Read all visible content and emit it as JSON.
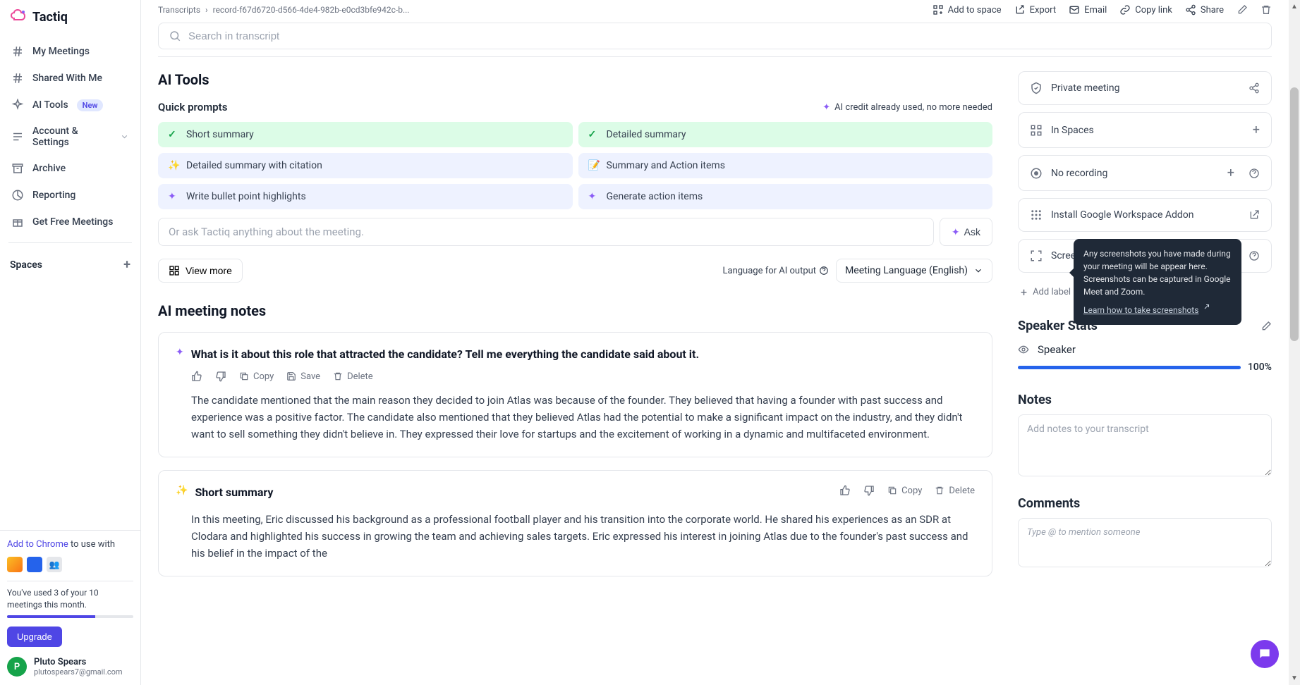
{
  "brand": "Tactiq",
  "sidebar": {
    "items": [
      {
        "label": "My Meetings"
      },
      {
        "label": "Shared With Me"
      },
      {
        "label": "AI Tools"
      },
      {
        "label": "Account & Settings"
      },
      {
        "label": "Archive"
      },
      {
        "label": "Reporting"
      },
      {
        "label": "Get Free Meetings"
      }
    ],
    "new_badge": "New",
    "spaces_label": "Spaces",
    "add_chrome_link": "Add to Chrome",
    "add_chrome_suffix": " to use with",
    "usage_text": "You've used 3 of your 10 meetings this month.",
    "upgrade": "Upgrade",
    "user_name": "Pluto Spears",
    "user_email": "plutospears7@gmail.com",
    "user_initial": "P"
  },
  "breadcrumb": {
    "root": "Transcripts",
    "current": "record-f67d6720-d566-4de4-982b-e0cd3bfe942c-b..."
  },
  "top_actions": {
    "add_space": "Add to space",
    "export": "Export",
    "email": "Email",
    "copy_link": "Copy link",
    "share": "Share"
  },
  "search_placeholder": "Search in transcript",
  "ai_tools_title": "AI Tools",
  "quick_prompts_label": "Quick prompts",
  "credit_text": "AI credit already used, no more needed",
  "prompts": {
    "short_summary": "Short summary",
    "detailed_summary": "Detailed summary",
    "detailed_citation": "Detailed summary with citation",
    "summary_actions": "Summary and Action items",
    "bullet_highlights": "Write bullet point highlights",
    "gen_actions": "Generate action items"
  },
  "ask_placeholder": "Or ask Tactiq anything about the meeting.",
  "ask_btn": "Ask",
  "view_more": "View more",
  "lang_label": "Language for AI output",
  "lang_value": "Meeting Language (English)",
  "notes_title": "AI meeting notes",
  "note1": {
    "title": "What is it about this role that attracted the candidate? Tell me everything the candidate said about it.",
    "body": "The candidate mentioned that the main reason they decided to join Atlas was because of the founder. They believed that having a founder with past success and experience was a positive factor. The candidate also mentioned that they believed Atlas had the potential to make a significant impact on the industry, and they didn't want to sell something they didn't believe in. They expressed their love for startups and the excitement of working in a dynamic and multifaceted environment."
  },
  "note2": {
    "title": "Short summary",
    "body": "In this meeting, Eric discussed his background as a professional football player and his transition into the corporate world. He shared his experiences as an SDR at Clodara and highlighted his success in growing the team and achieving sales targets. Eric expressed his interest in joining Atlas due to the founder's past success and his belief in the impact of the"
  },
  "note_actions": {
    "copy": "Copy",
    "save": "Save",
    "delete": "Delete"
  },
  "right": {
    "private": "Private meeting",
    "in_spaces": "In Spaces",
    "no_recording": "No recording",
    "install_addon": "Install Google Workspace Addon",
    "screenshots": "Screens",
    "add_label": "Add label",
    "speaker_stats": "Speaker Stats",
    "speaker": "Speaker",
    "percent": "100%",
    "notes": "Notes",
    "notes_placeholder": "Add notes to your transcript",
    "comments": "Comments",
    "comments_placeholder": "Type @ to mention someone"
  },
  "tooltip": {
    "text": "Any screenshots you have made during your meeting will be appear here. Screenshots can be captured in Google Meet and Zoom.",
    "link": "Learn how to take screenshots"
  }
}
